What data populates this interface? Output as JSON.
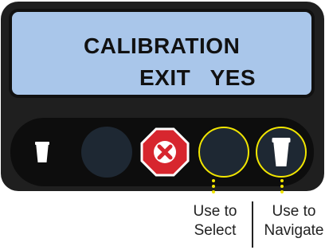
{
  "display": {
    "line1": "CALIBRATION",
    "line2": "EXIT   YES"
  },
  "buttons": [
    {
      "name": "small-cup-button",
      "icon": "small-cup-icon"
    },
    {
      "name": "blank-button"
    },
    {
      "name": "stop-cancel-button",
      "icon": "stop-x-icon"
    },
    {
      "name": "select-button"
    },
    {
      "name": "navigate-button",
      "icon": "large-cup-icon"
    }
  ],
  "labels": {
    "select": [
      "Use to",
      "Select"
    ],
    "navigate": [
      "Use to",
      "Navigate"
    ]
  },
  "colors": {
    "panel": "#1f1f1f",
    "display_bg": "#a9c6ea",
    "highlight": "#f2e600",
    "stop_red": "#d7262e"
  }
}
